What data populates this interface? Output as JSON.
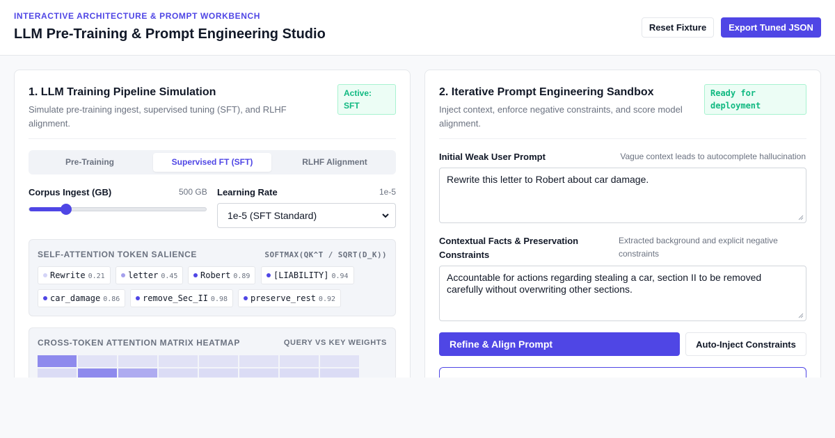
{
  "header": {
    "eyebrow": "INTERACTIVE ARCHITECTURE & PROMPT WORKBENCH",
    "title": "LLM Pre-Training & Prompt Engineering Studio",
    "reset_label": "Reset Fixture",
    "export_label": "Export Tuned JSON"
  },
  "pipeline": {
    "title": "1. LLM Training Pipeline Simulation",
    "description": "Simulate pre-training ingest, supervised tuning (SFT), and RLHF alignment.",
    "badge_line1": "Active:",
    "badge_line2": "SFT",
    "tabs": [
      {
        "label": "Pre-Training",
        "active": false
      },
      {
        "label": "Supervised FT (SFT)",
        "active": true
      },
      {
        "label": "RLHF Alignment",
        "active": false
      }
    ],
    "corpus": {
      "label": "Corpus Ingest (GB)",
      "value_text": "500 GB",
      "slider_fraction": 0.2
    },
    "learning_rate": {
      "label": "Learning Rate",
      "value_text": "1e-5",
      "selected": "1e-5 (SFT Standard)"
    },
    "salience": {
      "title": "SELF-ATTENTION TOKEN SALIENCE",
      "formula": "SOFTMAX(QK^T / SQRT(D_K))",
      "tokens": [
        {
          "token": "Rewrite",
          "score": "0.21"
        },
        {
          "token": "letter",
          "score": "0.45"
        },
        {
          "token": "Robert",
          "score": "0.89"
        },
        {
          "token": "[LIABILITY]",
          "score": "0.94"
        },
        {
          "token": "car_damage",
          "score": "0.86"
        },
        {
          "token": "remove_Sec_II",
          "score": "0.98"
        },
        {
          "token": "preserve_rest",
          "score": "0.92"
        }
      ]
    },
    "heatmap": {
      "title": "CROSS-TOKEN ATTENTION MATRIX HEATMAP",
      "subtitle": "QUERY VS KEY WEIGHTS",
      "rows": [
        [
          0.85,
          0.05,
          0.05,
          0.05,
          0.05,
          0.05,
          0.05,
          0.05
        ],
        [
          0.1,
          0.85,
          0.55,
          0.1,
          0.1,
          0.1,
          0.1,
          0.1
        ]
      ]
    },
    "colors": {
      "accent": "#4f46e5",
      "dot_low": "#d4d4f7",
      "dot_mid": "#a5a0ec"
    }
  },
  "sandbox": {
    "title": "2. Iterative Prompt Engineering Sandbox",
    "description": "Inject context, enforce negative constraints, and score model alignment.",
    "badge_line1": "Ready for",
    "badge_line2": "deployment",
    "weak_prompt": {
      "label": "Initial Weak User Prompt",
      "hint": "Vague context leads to autocomplete hallucination",
      "value": "Rewrite this letter to Robert about car damage."
    },
    "constraints": {
      "label_line1": "Contextual Facts & Preservation",
      "label_line2": "Constraints",
      "hint_line1": "Extracted background and explicit negative",
      "hint_line2": "constraints",
      "value_line1": "Accountable for actions regarding stealing a car, section II to be removed",
      "value_line2": "carefully without overwriting other sections."
    },
    "refine_label": "Refine & Align Prompt",
    "inject_label": "Auto-Inject Constraints"
  }
}
